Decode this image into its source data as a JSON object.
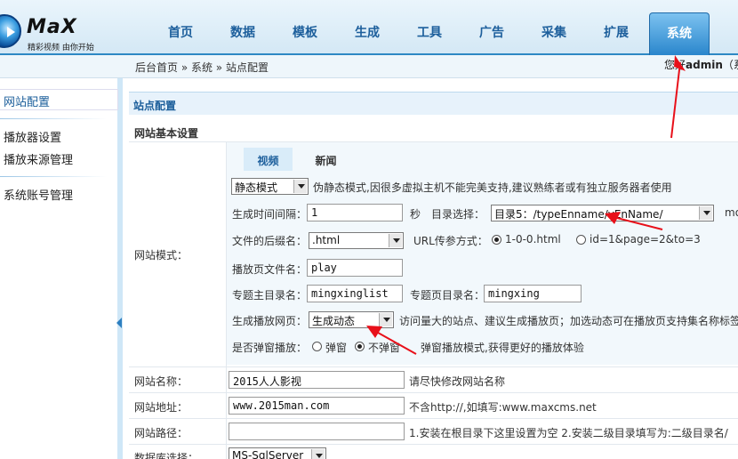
{
  "logo": {
    "text": "MaX",
    "slogan": "精彩视频 由你开始"
  },
  "nav": {
    "items": [
      "首页",
      "数据",
      "模板",
      "生成",
      "工具",
      "广告",
      "采集",
      "扩展",
      "系统"
    ],
    "active": "系统"
  },
  "breadcrumb": "后台首页 » 系统 » 站点配置",
  "greeting": {
    "prefix": "您好",
    "user": "admin",
    "suffix": "（系"
  },
  "sidebar": {
    "items": [
      "网站配置",
      "播放器设置",
      "播放来源管理",
      "系统账号管理"
    ],
    "active": "网站配置"
  },
  "panel": {
    "title": "站点配置",
    "section": "网站基本设置"
  },
  "mode": {
    "label": "网站模式：",
    "tabs": [
      "视频",
      "新闻"
    ],
    "active_tab": "视频",
    "static_mode": {
      "value": "静态模式",
      "hint": "伪静态模式,因很多虚拟主机不能完美支持,建议熟练者或有独立服务器者使用"
    },
    "interval": {
      "label": "生成时间间隔：",
      "value": "1",
      "unit": "秒"
    },
    "dir": {
      "label": "目录选择：",
      "value": "目录5：/typeEnname/vEnName/",
      "overflow": "mo"
    },
    "suffix": {
      "label": "文件的后缀名：",
      "value": ".html"
    },
    "url_param": {
      "label": "URL传参方式：",
      "opt1": "1-0-0.html",
      "opt2": "id=1&page=2&to=3",
      "selected": "1-0-0.html"
    },
    "play_filename": {
      "label": "播放页文件名：",
      "value": "play"
    },
    "topic_dir": {
      "label": "专题主目录名：",
      "value": "mingxinglist"
    },
    "topic_page_dir": {
      "label": "专题页目录名：",
      "value": "mingxing"
    },
    "gen_play": {
      "label": "生成播放网页：",
      "value": "生成动态",
      "hint": "访问量大的站点、建议生成播放页；加选动态可在播放页支持集名称标签"
    },
    "popup": {
      "label": "是否弹窗播放：",
      "opt1": "弹窗",
      "opt2": "不弹窗",
      "selected": "不弹窗",
      "hint": "弹窗播放模式,获得更好的播放体验"
    }
  },
  "site_name": {
    "label": "网站名称：",
    "value": "2015人人影视",
    "hint": "请尽快修改网站名称"
  },
  "site_url": {
    "label": "网站地址：",
    "value": "www.2015man.com",
    "hint": "不含http://,如填写:www.maxcms.net"
  },
  "site_path": {
    "label": "网站路径：",
    "value": "",
    "hint": "1.安装在根目录下这里设置为空 2.安装二级目录填写为:二级目录名/"
  },
  "db": {
    "label": "数据库选择：",
    "value": "MS-SqlServer"
  },
  "colors": {
    "nav_text": "#1d5f9c",
    "nav_active_bg": "#2a86cc",
    "annotation_arrow": "#e8101a",
    "panel_bg": "#f2f8fc"
  }
}
